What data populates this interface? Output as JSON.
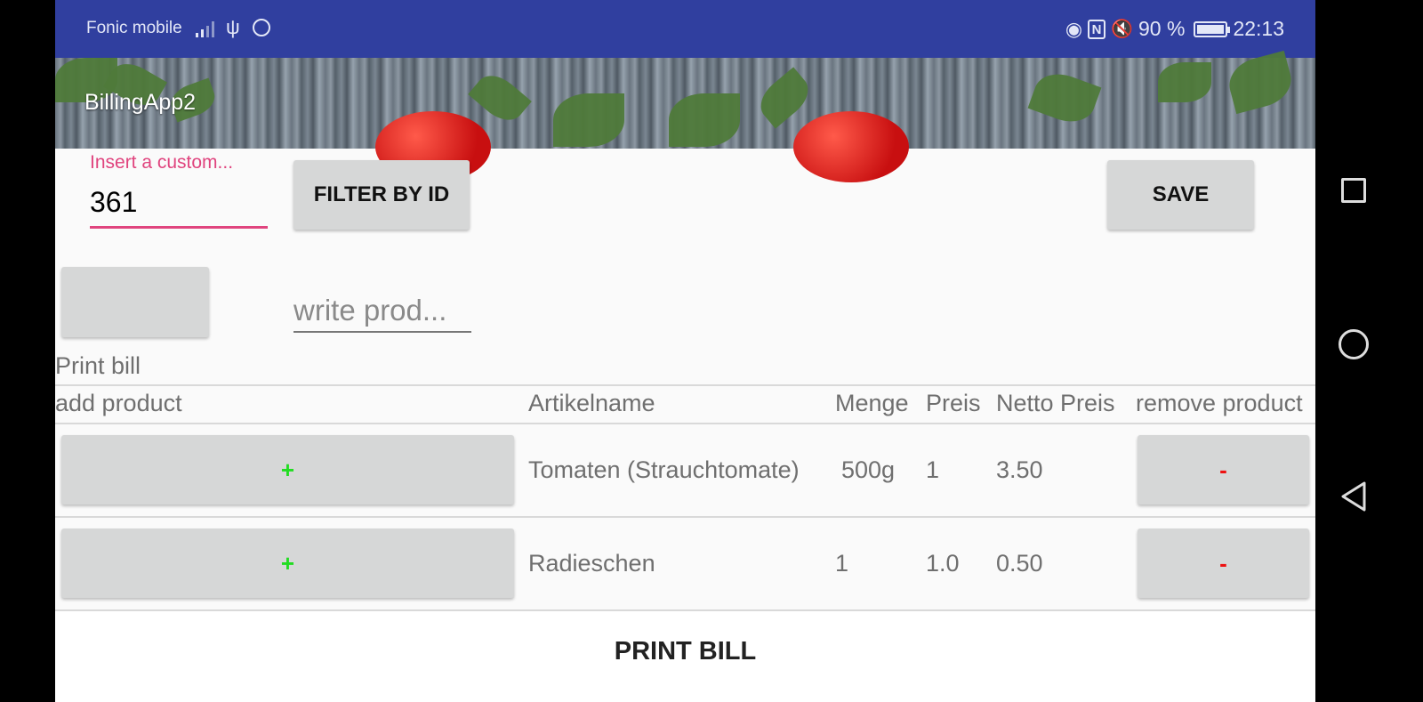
{
  "status_bar": {
    "carrier": "Fonic mobile",
    "battery": "90 %",
    "time": "22:13",
    "icons": [
      "signal-icon",
      "usb-icon",
      "whatsapp-icon",
      "eye-icon",
      "nfc-icon",
      "mute-icon",
      "battery-icon"
    ]
  },
  "app_bar": {
    "title": "BillingApp2"
  },
  "customer": {
    "label": "Insert a custom...",
    "value": "361",
    "filter_button": "FILTER BY ID",
    "save_button": "SAVE"
  },
  "product": {
    "placeholder": "write prod...",
    "print_label": "Print bill"
  },
  "table": {
    "headers": [
      "add product",
      "Artikelname",
      "Menge",
      "Preis",
      "Netto Preis",
      "remove product"
    ],
    "rows": [
      {
        "add": "+",
        "name": "Tomaten (Strauchtomate)",
        "menge": "500g",
        "preis": "1",
        "netto": "3.50",
        "remove": "-"
      },
      {
        "add": "+",
        "name": "Radieschen",
        "menge": "1",
        "preis": "1.0",
        "netto": "0.50",
        "remove": "-"
      }
    ]
  },
  "footer": {
    "print_button": "PRINT BILL"
  },
  "colors": {
    "status_bar": "#303f9f",
    "accent": "#e0447e",
    "plus": "#22dd22",
    "minus": "#ee1111"
  },
  "nav": {
    "icons": [
      "recents-icon",
      "home-icon",
      "back-icon"
    ]
  }
}
